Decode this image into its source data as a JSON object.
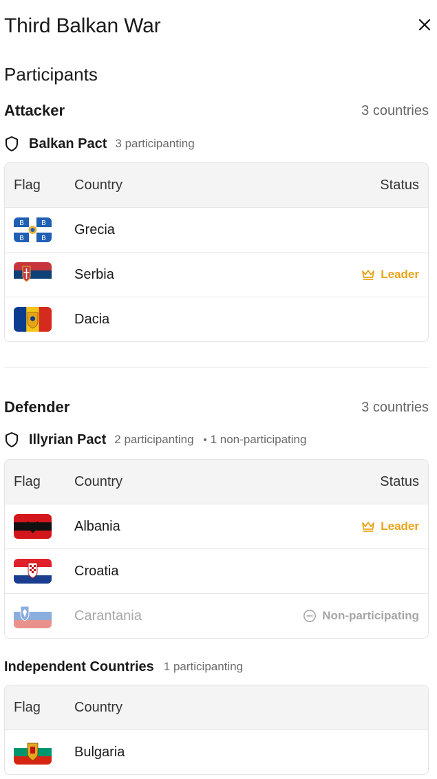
{
  "header": {
    "title": "Third Balkan War",
    "close_icon": "close-icon"
  },
  "section_title": "Participants",
  "columns": {
    "flag": "Flag",
    "country": "Country",
    "status": "Status"
  },
  "attacker": {
    "side_name": "Attacker",
    "count_label": "3 countries",
    "pact_name": "Balkan Pact",
    "pact_participating": "3 participanting",
    "rows": [
      {
        "country": "Grecia",
        "flag_icon": "flag-greece-icon",
        "status": ""
      },
      {
        "country": "Serbia",
        "flag_icon": "flag-serbia-icon",
        "status": "Leader"
      },
      {
        "country": "Dacia",
        "flag_icon": "flag-dacia-icon",
        "status": ""
      }
    ]
  },
  "defender": {
    "side_name": "Defender",
    "count_label": "3 countries",
    "pact_name": "Illyrian Pact",
    "pact_participating": "2 participanting",
    "pact_nonparticipating": "1 non-participating",
    "rows": [
      {
        "country": "Albania",
        "flag_icon": "flag-albania-icon",
        "status": "Leader"
      },
      {
        "country": "Croatia",
        "flag_icon": "flag-croatia-icon",
        "status": ""
      },
      {
        "country": "Carantania",
        "flag_icon": "flag-carantania-icon",
        "status": "Non-participating"
      }
    ]
  },
  "independent": {
    "title": "Independent Countries",
    "participating": "1 participanting",
    "rows": [
      {
        "country": "Bulgaria",
        "flag_icon": "flag-bulgaria-icon"
      }
    ]
  },
  "colors": {
    "leader": "#e9a317",
    "muted": "#a6a6a6",
    "header_bg": "#f4f4f4",
    "border": "#e3e3e3"
  }
}
